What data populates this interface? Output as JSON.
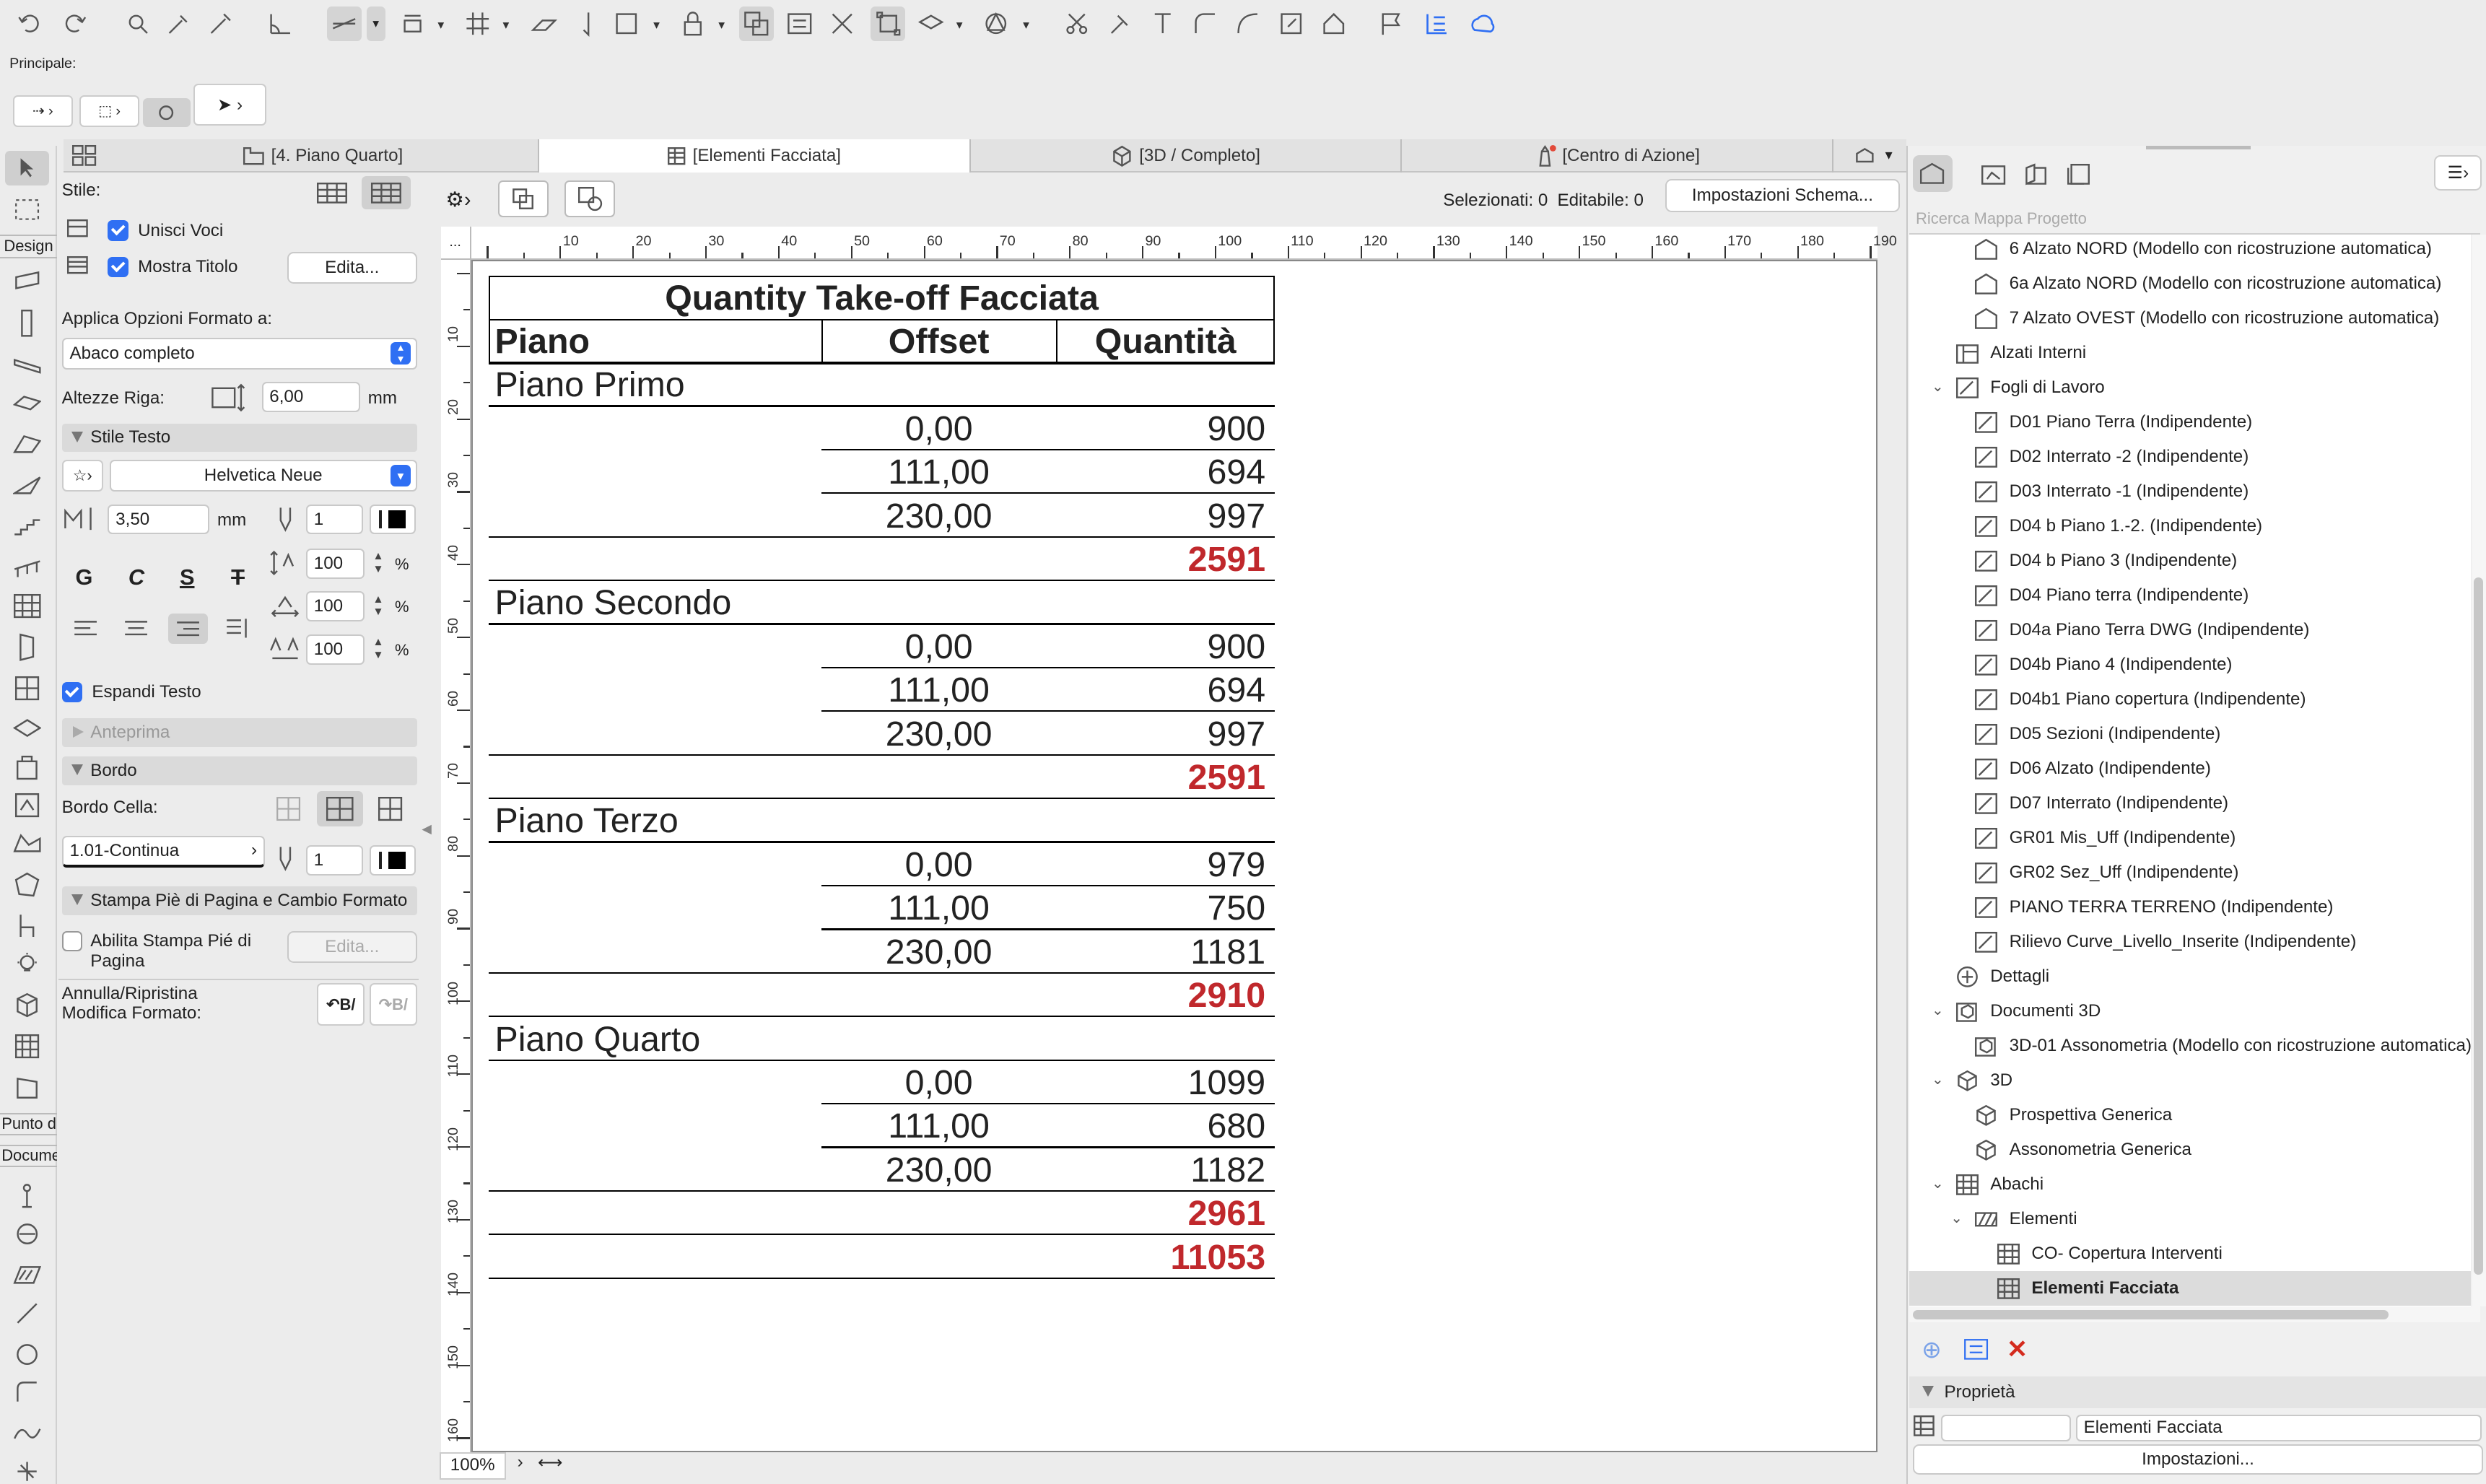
{
  "toolbar": {
    "principale_label": "Principale:"
  },
  "tabs": [
    {
      "label": "[4. Piano Quarto]"
    },
    {
      "label": "[Elementi Facciata]"
    },
    {
      "label": "[3D / Completo]"
    },
    {
      "label": "[Centro di Azione]"
    }
  ],
  "toolbox": {
    "design_label": "Design",
    "punto_label": "Punto d",
    "docume_label": "Docume"
  },
  "left_panel": {
    "stile_label": "Stile:",
    "unisci_voci": "Unisci Voci",
    "mostra_titolo": "Mostra Titolo",
    "edita_label": "Edita...",
    "applica_label": "Applica Opzioni Formato a:",
    "applica_value": "Abaco completo",
    "altezze_label": "Altezze Riga:",
    "altezze_value": "6,00",
    "unit_mm": "mm",
    "stile_testo_header": "Stile Testo",
    "font_value": "Helvetica Neue",
    "size_value": "3,50",
    "pen_value": "1",
    "bold_label": "G",
    "italic_label": "C",
    "underline_label": "S",
    "strike_label": "T",
    "scale1": "100",
    "scale2": "100",
    "scale3": "100",
    "pct": "%",
    "espandi_testo": "Espandi Testo",
    "anteprima_header": "Anteprima",
    "bordo_header": "Bordo",
    "bordo_cella_label": "Bordo Cella:",
    "bordo_linea": "1.01-Continua",
    "bordo_pen": "1",
    "stampa_header": "Stampa Piè di Pagina e Cambio Formato",
    "abilita_line1": "Abilita Stampa Pié di",
    "abilita_line2": "Pagina",
    "edita_disabled": "Edita...",
    "annulla_line1": "Annulla/Ripristina",
    "annulla_line2": "Modifica Formato:"
  },
  "schedule_toolbar": {
    "selezionati": "Selezionati: 0",
    "editabile": "Editabile: 0",
    "impostazioni": "Impostazioni Schema..."
  },
  "ruler": {
    "h_ticks": [
      "10",
      "20",
      "30",
      "40",
      "50",
      "60",
      "70",
      "80",
      "90",
      "100",
      "110",
      "120",
      "130",
      "140",
      "150",
      "160",
      "170",
      "180",
      "190"
    ],
    "v_ticks": [
      "10",
      "20",
      "30",
      "40",
      "50",
      "60",
      "70",
      "80",
      "90",
      "100",
      "110",
      "120",
      "130",
      "140",
      "150",
      "160"
    ],
    "corner": "..."
  },
  "zoom": {
    "value": "100%"
  },
  "schedule": {
    "title": "Quantity Take-off Facciata",
    "headers": [
      "Piano",
      "Offset",
      "Quantità"
    ],
    "groups": [
      {
        "name": "Piano Primo",
        "rows": [
          [
            "0,00",
            "900"
          ],
          [
            "111,00",
            "694"
          ],
          [
            "230,00",
            "997"
          ]
        ],
        "total": "2591"
      },
      {
        "name": "Piano Secondo",
        "rows": [
          [
            "0,00",
            "900"
          ],
          [
            "111,00",
            "694"
          ],
          [
            "230,00",
            "997"
          ]
        ],
        "total": "2591"
      },
      {
        "name": "Piano Terzo",
        "rows": [
          [
            "0,00",
            "979"
          ],
          [
            "111,00",
            "750"
          ],
          [
            "230,00",
            "1181"
          ]
        ],
        "total": "2910"
      },
      {
        "name": "Piano Quarto",
        "rows": [
          [
            "0,00",
            "1099"
          ],
          [
            "111,00",
            "680"
          ],
          [
            "230,00",
            "1182"
          ]
        ],
        "total": "2961"
      }
    ],
    "grand_total": "11053"
  },
  "navigator": {
    "search_placeholder": "Ricerca Mappa Progetto",
    "items": [
      {
        "label": "6 Alzato NORD (Modello con ricostruzione automatica)",
        "icon": "elevation-icon"
      },
      {
        "label": "6a Alzato NORD (Modello con ricostruzione automatica)",
        "icon": "elevation-icon"
      },
      {
        "label": "7 Alzato OVEST (Modello con ricostruzione automatica)",
        "icon": "elevation-icon"
      },
      {
        "label": "Alzati Interni",
        "icon": "interior-elevation-icon"
      },
      {
        "label": "Fogli di Lavoro",
        "icon": "worksheet-folder-icon"
      },
      {
        "label": "D01 Piano Terra (Indipendente)",
        "icon": "worksheet-icon"
      },
      {
        "label": "D02 Interrato -2 (Indipendente)",
        "icon": "worksheet-icon"
      },
      {
        "label": "D03 Interrato -1 (Indipendente)",
        "icon": "worksheet-icon"
      },
      {
        "label": "D04 b Piano 1.-2.  (Indipendente)",
        "icon": "worksheet-icon"
      },
      {
        "label": "D04 b Piano 3 (Indipendente)",
        "icon": "worksheet-icon"
      },
      {
        "label": "D04 Piano terra (Indipendente)",
        "icon": "worksheet-icon"
      },
      {
        "label": "D04a Piano Terra DWG (Indipendente)",
        "icon": "worksheet-icon"
      },
      {
        "label": "D04b Piano 4 (Indipendente)",
        "icon": "worksheet-icon"
      },
      {
        "label": "D04b1 Piano copertura (Indipendente)",
        "icon": "worksheet-icon"
      },
      {
        "label": "D05 Sezioni (Indipendente)",
        "icon": "worksheet-icon"
      },
      {
        "label": "D06 Alzato (Indipendente)",
        "icon": "worksheet-icon"
      },
      {
        "label": "D07 Interrato (Indipendente)",
        "icon": "worksheet-icon"
      },
      {
        "label": "GR01 Mis_Uff (Indipendente)",
        "icon": "worksheet-icon"
      },
      {
        "label": "GR02 Sez_Uff (Indipendente)",
        "icon": "worksheet-icon"
      },
      {
        "label": "PIANO TERRA  TERRENO (Indipendente)",
        "icon": "worksheet-icon"
      },
      {
        "label": "Rilievo Curve_Livello_Inserite (Indipendente)",
        "icon": "worksheet-icon"
      },
      {
        "label": "Dettagli",
        "icon": "details-icon"
      },
      {
        "label": "Documenti 3D",
        "icon": "document-3d-folder-icon"
      },
      {
        "label": "3D-01 Assonometria (Modello con ricostruzione automatica)",
        "icon": "document-3d-icon"
      },
      {
        "label": "3D",
        "icon": "3d-folder-icon"
      },
      {
        "label": "Prospettiva Generica",
        "icon": "perspective-icon"
      },
      {
        "label": "Assonometria Generica",
        "icon": "axonometry-icon"
      },
      {
        "label": "Abachi",
        "icon": "schedule-folder-icon"
      },
      {
        "label": "Elementi",
        "icon": "elements-folder-icon"
      },
      {
        "label": "CO- Copertura Interventi",
        "icon": "schedule-icon"
      },
      {
        "label": "Elementi Facciata",
        "icon": "schedule-icon"
      }
    ],
    "proprieta_header": "Proprietà",
    "prop_id": "",
    "prop_name": "Elementi Facciata",
    "impostazioni": "Impostazioni..."
  }
}
